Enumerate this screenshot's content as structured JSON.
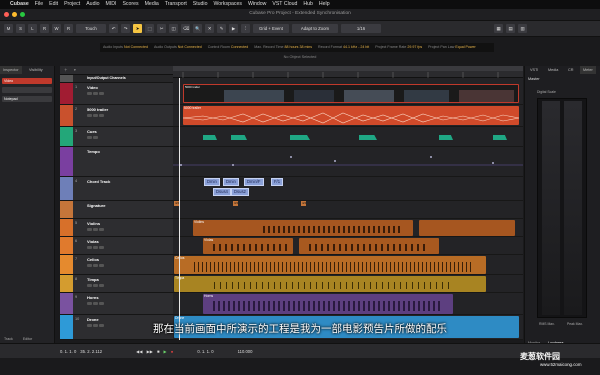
{
  "menubar": {
    "apple": "",
    "items": [
      "Cubase",
      "File",
      "Edit",
      "Project",
      "Audio",
      "MIDI",
      "Scores",
      "Media",
      "Transport",
      "Studio",
      "Workspaces",
      "Window",
      "VST Cloud",
      "Hub",
      "Help"
    ]
  },
  "window": {
    "title": "Cubase Pro Project - Extended Synchronisation"
  },
  "toolbar": {
    "buttons": [
      "M",
      "S",
      "L",
      "R",
      "W",
      "R"
    ],
    "snap_mode": "Touch",
    "grid": "Grid + Event",
    "zoom": "Adapt to Zoom",
    "quantize": "1/16"
  },
  "status": [
    {
      "label": "Audio Inputs",
      "value": "Not Connected"
    },
    {
      "label": "Audio Outputs",
      "value": "Not Connected"
    },
    {
      "label": "Control Room",
      "value": "Connected"
    },
    {
      "label": "Max. Record Time",
      "value": "88 hours 38 mins"
    },
    {
      "label": "Record Format",
      "value": "44.1 kHz - 24 bit"
    },
    {
      "label": "Project Frame Rate",
      "value": "29.97 fps"
    },
    {
      "label": "Project Pan Law",
      "value": "Equal Power"
    }
  ],
  "no_object": "No Object Selected",
  "left_panel": {
    "tabs": [
      "Inspector",
      "Visibility"
    ],
    "rows": [
      {
        "label": "Video",
        "color": "#c0392b"
      },
      {
        "label": "Notepad",
        "color": "#3a3a3d"
      }
    ],
    "bottom_tabs": [
      "Track",
      "Editor"
    ]
  },
  "track_header": {
    "label": "Input/Output Channels"
  },
  "tracks": [
    {
      "num": "1",
      "name": "Video",
      "color": "#a11c32"
    },
    {
      "num": "2",
      "name": "5000 trailer",
      "color": "#c9512d"
    },
    {
      "num": "3",
      "name": "Cues",
      "color": "#23a779"
    },
    {
      "num": "",
      "name": "Tempo",
      "color": "#7a3fa0"
    },
    {
      "num": "4",
      "name": "Chord Track",
      "color": "#6e7fb8"
    },
    {
      "num": "",
      "name": "Signature",
      "color": "#c4753a"
    },
    {
      "num": "5",
      "name": "Violins",
      "color": "#d7702a"
    },
    {
      "num": "6",
      "name": "Violas",
      "color": "#e07a2d"
    },
    {
      "num": "7",
      "name": "Cellos",
      "color": "#e58a2e"
    },
    {
      "num": "8",
      "name": "Timpa",
      "color": "#d49c2f"
    },
    {
      "num": "9",
      "name": "Horns",
      "color": "#7a52a0"
    },
    {
      "num": "10",
      "name": "Drone",
      "color": "#2e9ad7"
    }
  ],
  "events": {
    "video": "5000 trailer",
    "audio": "5000 trailer",
    "violins": "Violins",
    "violas": "Violas",
    "cellos": "Cellos",
    "timpa": "Timpa",
    "horns": "Horns",
    "drone": "Drone"
  },
  "chords": [
    "Dmin",
    "Dmin",
    "Dmin/F",
    "F/1",
    "Dsus4",
    "Dsus2"
  ],
  "signatures": [
    "4/4",
    "3/4",
    "4/4"
  ],
  "right_panel": {
    "tabs": [
      "VSTi",
      "Media",
      "CR",
      "Meter"
    ],
    "section": "Master",
    "digital_scale": "Digital Scale",
    "rms_label": "RMS Max.",
    "peak_label": "Peak Max.",
    "bottom_tabs": [
      "Monitor",
      "Loudness"
    ]
  },
  "transport": {
    "position1": "0. 1. 1. 0",
    "position2": "35. 2. 2.112",
    "position3": "0. 1. 1. 0",
    "tempo": "110.000"
  },
  "subtitle": "那在当前画面中所演示的工程是我为一部电影预告片所做的配乐",
  "watermark": {
    "title": "麦葱软件园",
    "url": "www.52maicong.com"
  }
}
